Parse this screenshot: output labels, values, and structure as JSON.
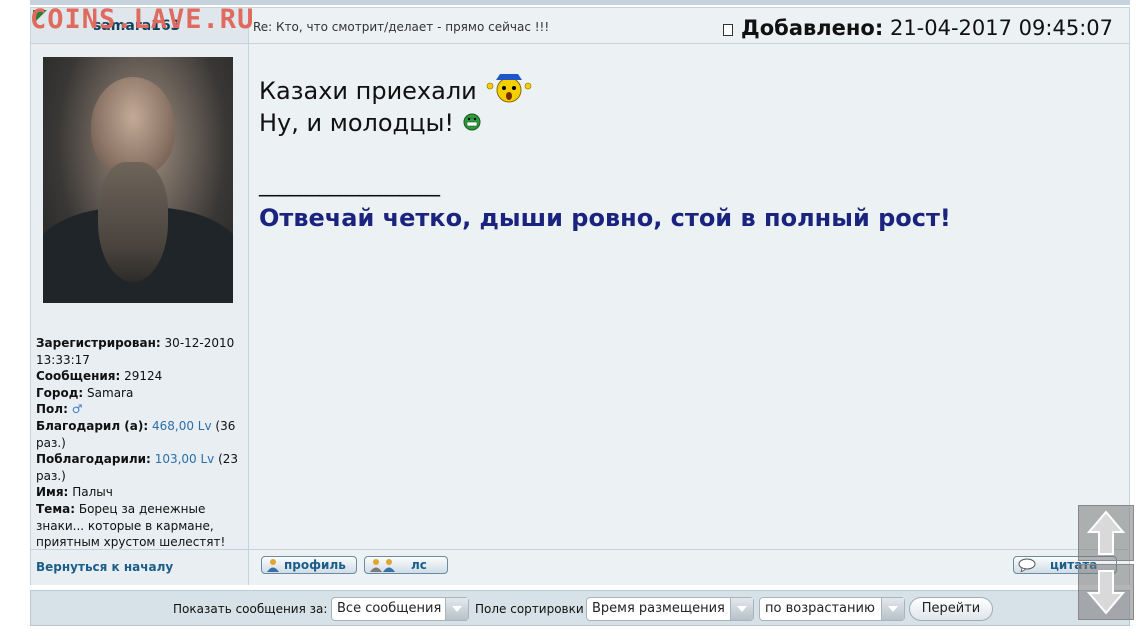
{
  "watermark": "COINS.LAVE.RU",
  "post": {
    "username": "samara163",
    "subject": "Re: Кто, что смотрит/делает - прямо сейчас !!!",
    "added_label": "Добавлено:",
    "added_value": "21-04-2017 09:45:07",
    "line1": "Казахи приехали",
    "line2": "Ну, и молодцы!",
    "signature_separator": "__________________",
    "signature": "Отвечай четко, дыши ровно, стой в полный рост!"
  },
  "profile": {
    "registered_label": "Зарегистрирован:",
    "registered_value": "30-12-2010 13:33:17",
    "messages_label": "Сообщения:",
    "messages_value": "29124",
    "city_label": "Город:",
    "city_value": "Samara",
    "gender_label": "Пол:",
    "gender_icon": "male-icon",
    "thanked_label": "Благодарил (а):",
    "thanked_amount": "468,00 Lv",
    "thanked_count": "(36 раз.)",
    "thanked_by_label": "Поблагодарили:",
    "thanked_by_amount": "103,00 Lv",
    "thanked_by_count": "(23 раз.)",
    "name_label": "Имя:",
    "name_value": "Палыч",
    "theme_label": "Тема:",
    "theme_value": "Борец за денежные знаки... которые в кармане, приятным хрустом шелестят!"
  },
  "footer": {
    "back_to_top": "Вернуться к началу",
    "profile_button": "профиль",
    "pm_button": "лс",
    "quote_button": "цитата"
  },
  "bottom_bar": {
    "show_label": "Показать сообщения за:",
    "show_select": "Все сообщения",
    "sort_label": "Поле сортировки",
    "sort_select": "Время размещения",
    "order_select": "по возрастанию",
    "go_button": "Перейти"
  },
  "colors": {
    "signature": "#1a237e",
    "link": "#2a6fa8",
    "watermark": "#e06a5e"
  }
}
